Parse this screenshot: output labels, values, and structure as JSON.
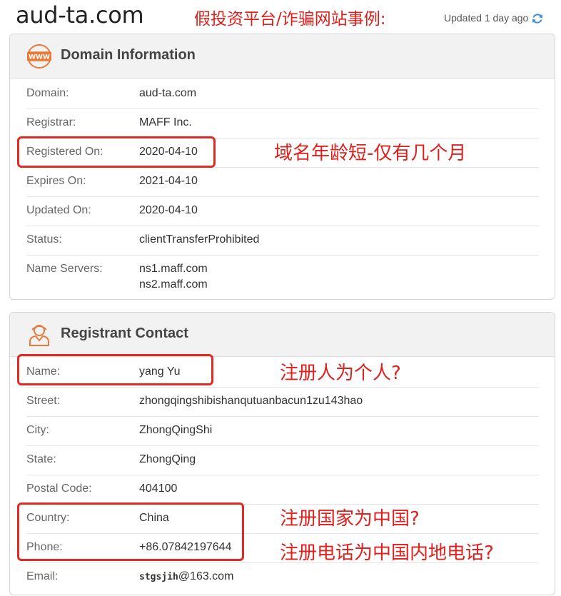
{
  "header": {
    "site": "aud-ta.com",
    "heading_cn": "假投资平台/诈骗网站事例:",
    "updated": "Updated 1 day ago"
  },
  "domain_card": {
    "title": "Domain Information",
    "rows": [
      {
        "label": "Domain:",
        "value": "aud-ta.com"
      },
      {
        "label": "Registrar:",
        "value": "MAFF Inc."
      },
      {
        "label": "Registered On:",
        "value": "2020-04-10"
      },
      {
        "label": "Expires On:",
        "value": "2021-04-10"
      },
      {
        "label": "Updated On:",
        "value": "2020-04-10"
      },
      {
        "label": "Status:",
        "value": "clientTransferProhibited"
      },
      {
        "label": "Name Servers:",
        "value": "ns1.maff.com",
        "value2": "ns2.maff.com"
      }
    ]
  },
  "contact_card": {
    "title": "Registrant Contact",
    "rows": [
      {
        "label": "Name:",
        "value": "yang Yu"
      },
      {
        "label": "Street:",
        "value": "zhongqingshibishanqutuanbacun1zu143hao"
      },
      {
        "label": "City:",
        "value": "ZhongQingShi"
      },
      {
        "label": "State:",
        "value": "ZhongQing"
      },
      {
        "label": "Postal Code:",
        "value": "404100"
      },
      {
        "label": "Country:",
        "value": "China"
      },
      {
        "label": "Phone:",
        "value": "+86.07842197644"
      },
      {
        "label": "Email:",
        "value_user": "stgsjih",
        "value_domain": "@163.com"
      }
    ]
  },
  "annotations": {
    "domain_age": "域名年龄短-仅有几个月",
    "personal": "注册人为个人?",
    "country": "注册国家为中国?",
    "phone": "注册电话为中国内地电话?"
  },
  "colors": {
    "annotation": "#e0201d",
    "accent_icon": "#e87b3a",
    "refresh": "#3b8fd9"
  }
}
